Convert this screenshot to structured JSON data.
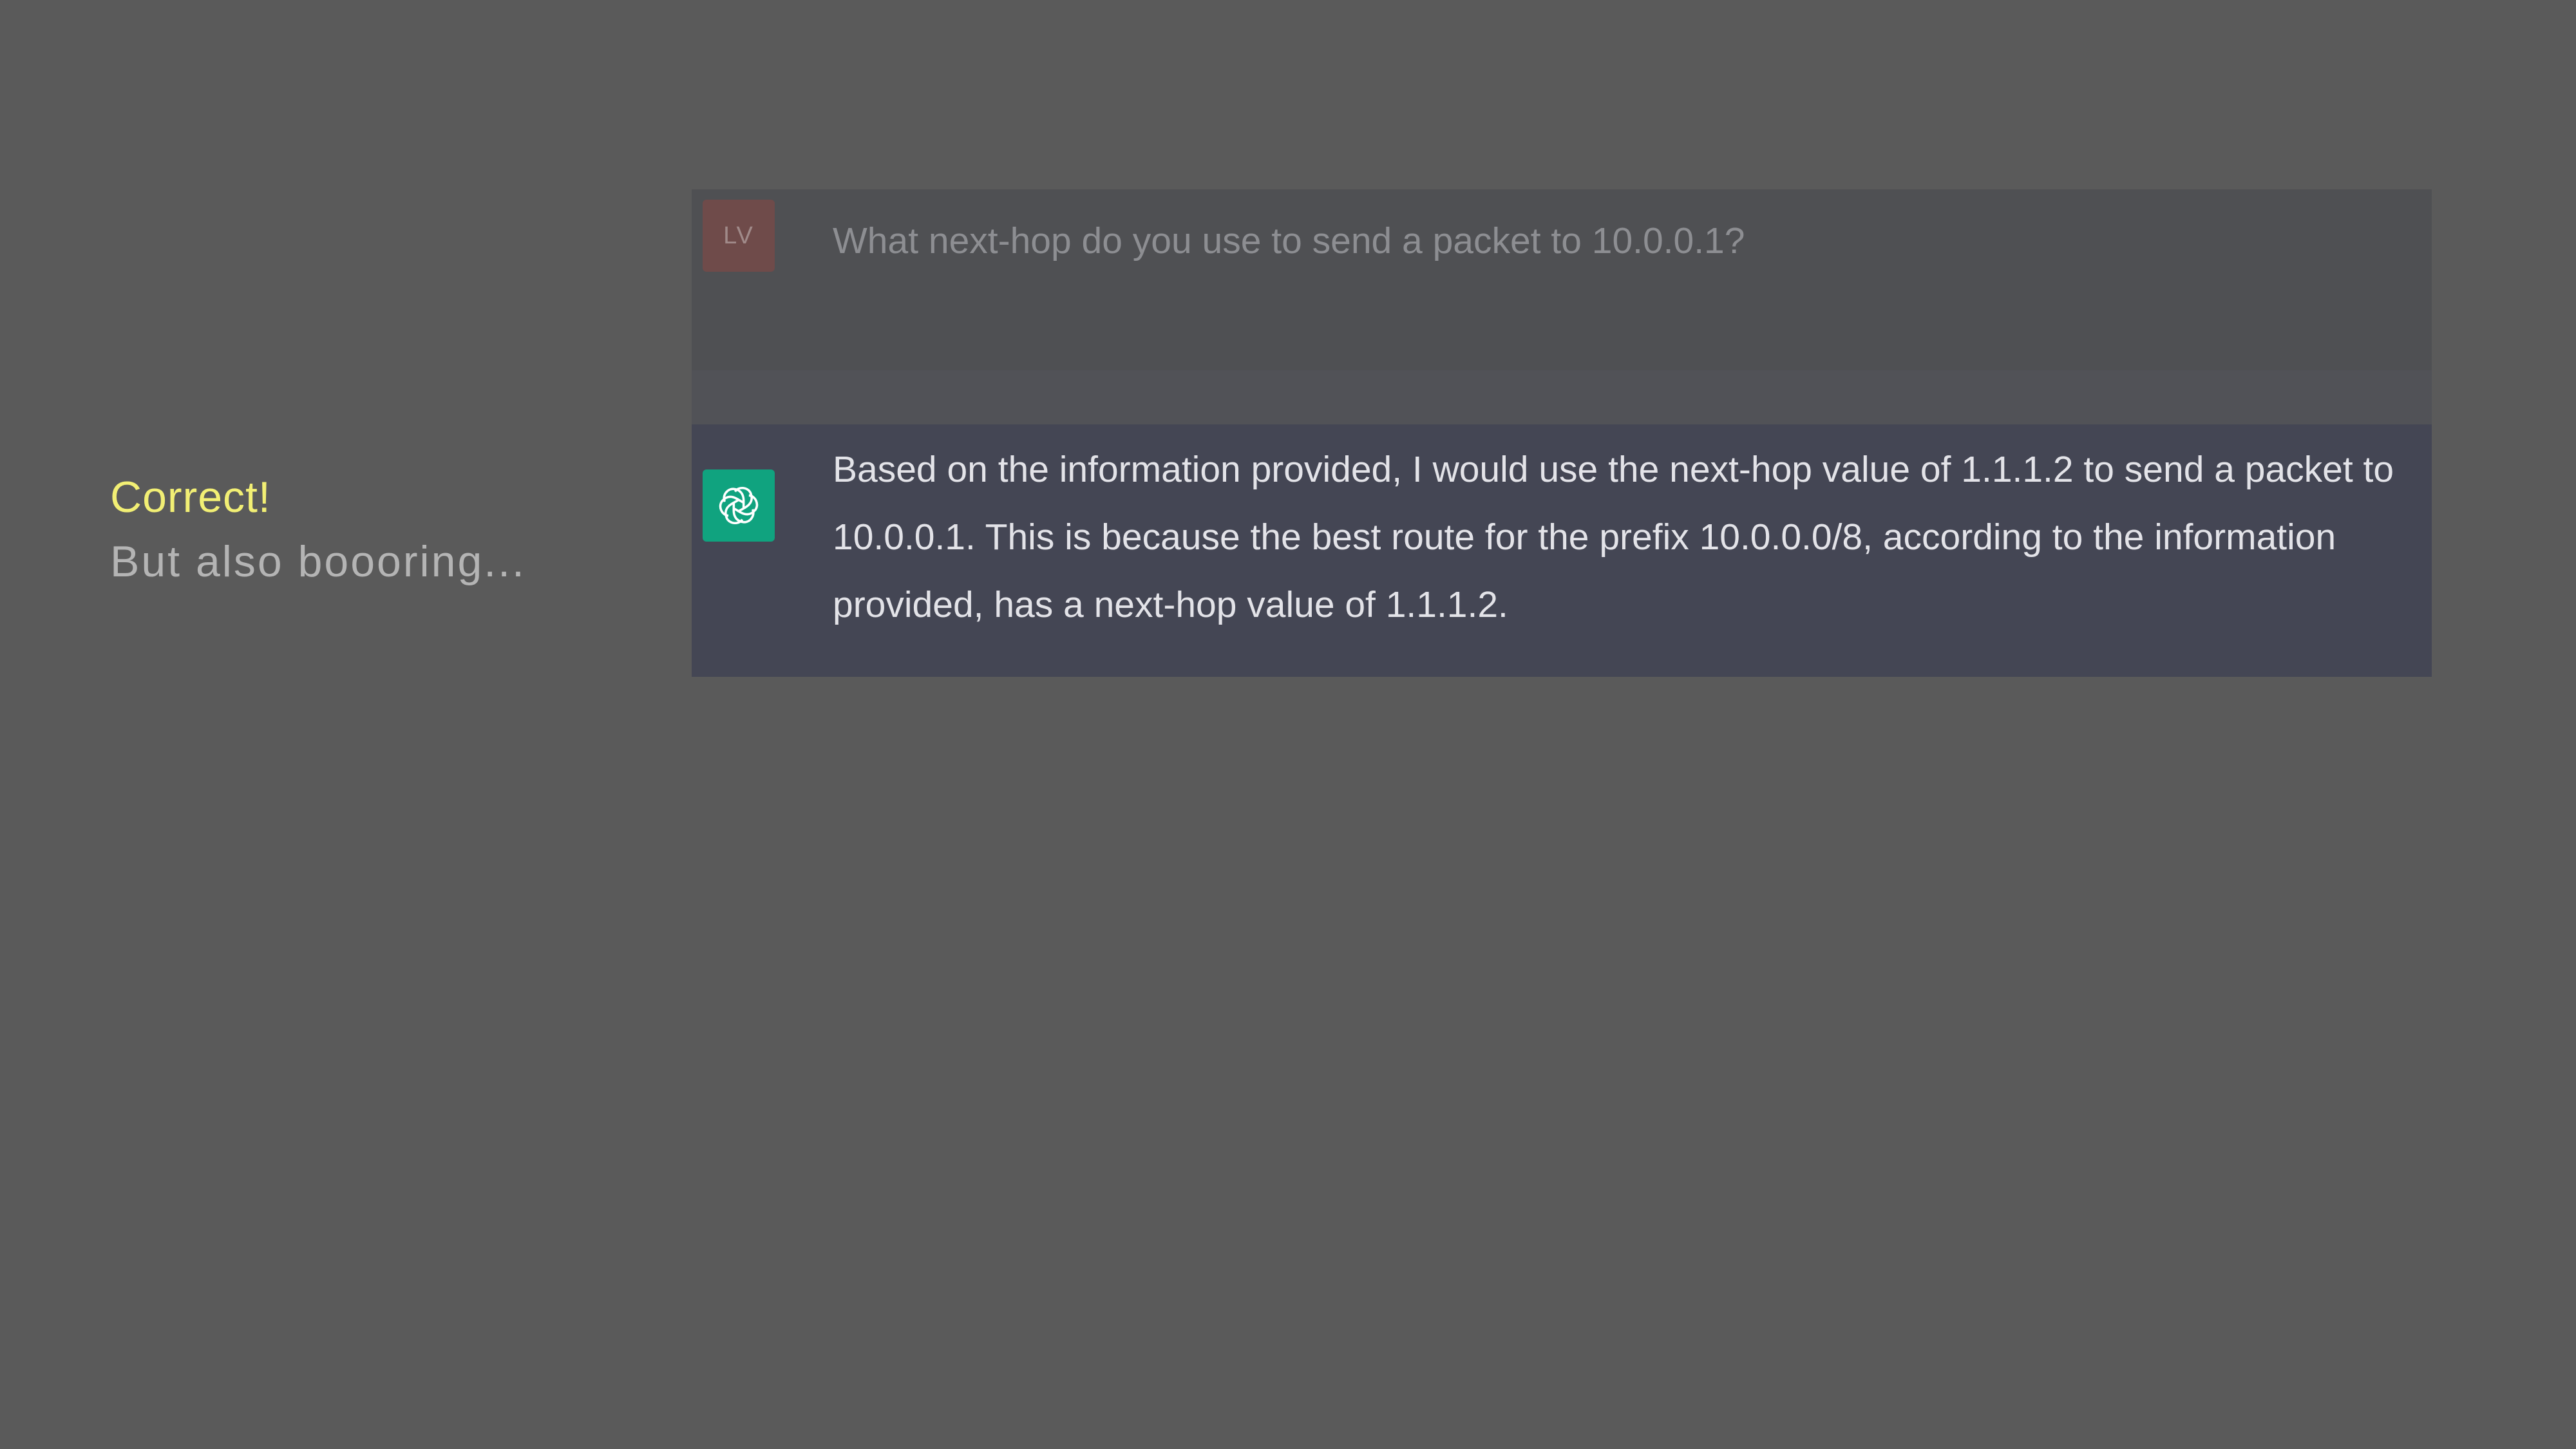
{
  "annotation": {
    "verdict": "Correct!",
    "comment": "But also boooring..."
  },
  "conversation": {
    "user_message": {
      "avatar_initials": "LV",
      "avatar_color": "#6f4b4a",
      "text": "What next-hop do you use to send a packet to 10.0.0.1?"
    },
    "assistant_message": {
      "avatar_icon": "openai-logo-icon",
      "avatar_color": "#10a37f",
      "text": "Based on the information provided, I would use the next-hop value of 1.1.1.2 to send a packet to 10.0.0.1. This is because the best route for the prefix 10.0.0.0/8, according to the information provided, has a next-hop value of 1.1.1.2."
    }
  },
  "colors": {
    "background": "#5a5a5a",
    "verdict_text": "#f2ef74",
    "assistant_bg": "#444654",
    "user_bg": "#4f5053"
  }
}
